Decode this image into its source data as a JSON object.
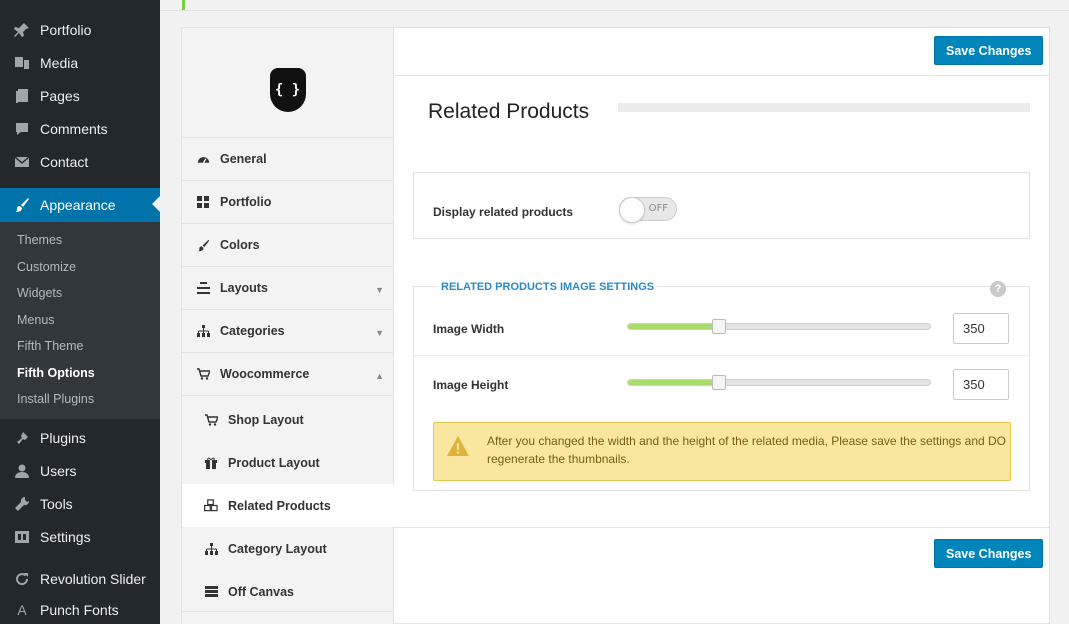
{
  "wp_menu": {
    "items": [
      {
        "label": "Portfolio",
        "icon": "pin-icon"
      },
      {
        "label": "Media",
        "icon": "media-icon"
      },
      {
        "label": "Pages",
        "icon": "pages-icon"
      },
      {
        "label": "Comments",
        "icon": "comment-icon"
      },
      {
        "label": "Contact",
        "icon": "mail-icon"
      },
      {
        "label": "Appearance",
        "icon": "brush-icon",
        "active": true
      },
      {
        "label": "Plugins",
        "icon": "plug-icon"
      },
      {
        "label": "Users",
        "icon": "user-icon"
      },
      {
        "label": "Tools",
        "icon": "wrench-icon"
      },
      {
        "label": "Settings",
        "icon": "settings-icon"
      },
      {
        "label": "Revolution Slider",
        "icon": "refresh-icon"
      },
      {
        "label": "Punch Fonts",
        "icon": "font-icon"
      }
    ],
    "appearance_sub": [
      "Themes",
      "Customize",
      "Widgets",
      "Menus",
      "Fifth Theme",
      "Fifth Options",
      "Install Plugins"
    ],
    "appearance_sub_current": "Fifth Options"
  },
  "options_nav": {
    "logo_text": "{ }",
    "items": [
      {
        "label": "General",
        "icon": "dashboard-icon"
      },
      {
        "label": "Portfolio",
        "icon": "grid-icon"
      },
      {
        "label": "Colors",
        "icon": "brush-icon"
      },
      {
        "label": "Layouts",
        "icon": "layout-icon",
        "caret": "down"
      },
      {
        "label": "Categories",
        "icon": "sitemap-icon",
        "caret": "down"
      },
      {
        "label": "Woocommerce",
        "icon": "cart-icon",
        "caret": "up"
      }
    ],
    "woo_sub": [
      {
        "label": "Shop Layout",
        "icon": "cart-icon"
      },
      {
        "label": "Product Layout",
        "icon": "gift-icon"
      },
      {
        "label": "Related Products",
        "icon": "cubes-icon",
        "current": true
      },
      {
        "label": "Category Layout",
        "icon": "sitemap-icon"
      },
      {
        "label": "Off Canvas",
        "icon": "list-icon"
      }
    ]
  },
  "main": {
    "save_top": "Save Changes",
    "save_bottom": "Save Changes",
    "section_title": "Related Products",
    "display_related": {
      "label": "Display related products",
      "toggle_text": "OFF",
      "on": false
    },
    "image_settings": {
      "legend": "RELATED PRODUCTS IMAGE SETTINGS",
      "help": "?",
      "width": {
        "label": "Image Width",
        "value": "350",
        "slider_fraction": 0.3
      },
      "height": {
        "label": "Image Height",
        "value": "350",
        "slider_fraction": 0.3
      }
    },
    "warning": "After you changed the width and the height of the related media, Please save the settings and DO regenerate the thumbnails."
  },
  "colors": {
    "accent": "#0085ba",
    "wp_sidebar": "#23282d",
    "slider_fill": "#a9dd6b",
    "warning_bg": "#f9e79f"
  }
}
